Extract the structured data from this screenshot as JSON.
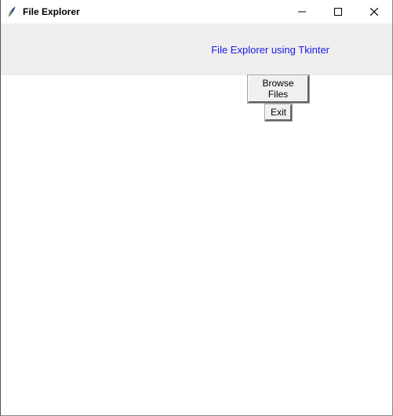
{
  "window": {
    "title": "File Explorer"
  },
  "header": {
    "label": "File Explorer using Tkinter"
  },
  "buttons": {
    "browse": "Browse Files",
    "exit": "Exit"
  }
}
